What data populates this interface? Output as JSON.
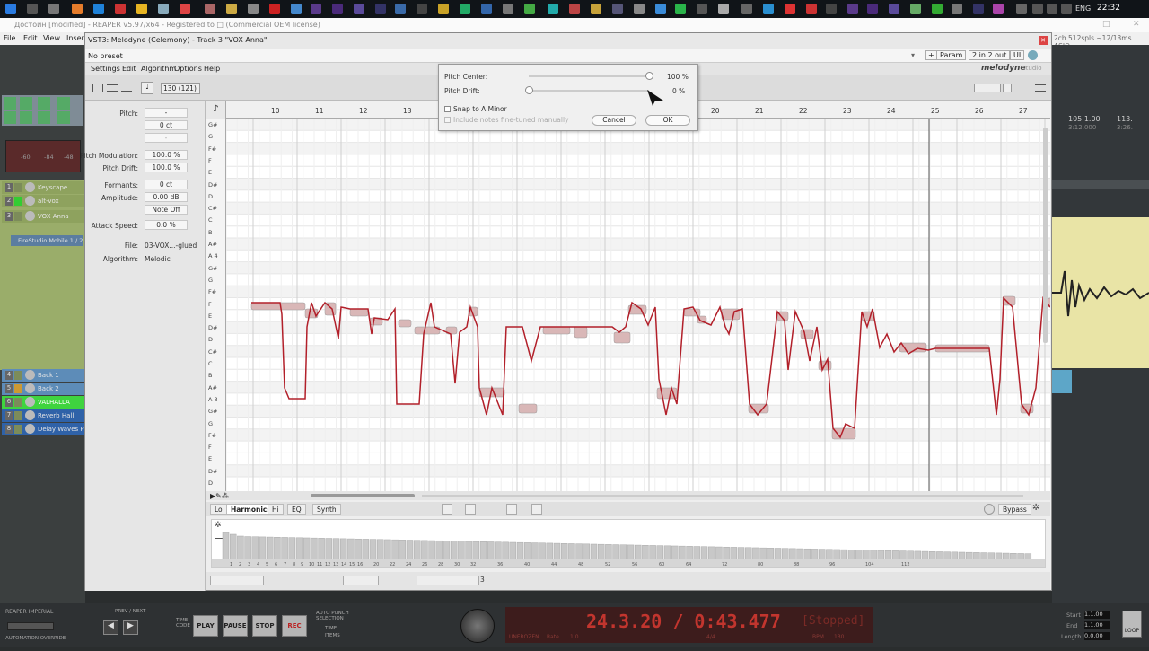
{
  "taskbar": {
    "lang": "ENG",
    "time": "22:32"
  },
  "app": {
    "title": "Достоин [modified] - REAPER v5.97/x64 - Registered to □ (Commercial OEM license)",
    "status_right": "2ch 512spls ~12/13ms ASIO"
  },
  "menu": [
    "File",
    "Edit",
    "View",
    "Insert"
  ],
  "plugin": {
    "title": "VST3: Melodyne (Celemony) - Track 3 \"VOX Anna\"",
    "preset": "No preset",
    "param_btn": "Param",
    "io_btn": "2 in 2 out",
    "ui_btn": "UI",
    "plus_btn": "+",
    "close_btn": "x"
  },
  "melodyne": {
    "logo": "melodyne",
    "logo_sub": "studio",
    "menu": [
      "Settings",
      "Edit",
      "Algorithm",
      "Options",
      "Help"
    ],
    "tempo": "130 (121)"
  },
  "inspector": {
    "pitch_label": "Pitch:",
    "pitch_val": "-",
    "pitch_ct": "0 ct",
    "pitch_extra": "-",
    "pitch_mod_label": "Pitch Modulation:",
    "pitch_mod": "100.0 %",
    "pitch_drift_label": "Pitch Drift:",
    "pitch_drift": "100.0 %",
    "formants_label": "Formants:",
    "formants": "0 ct",
    "amplitude_label": "Amplitude:",
    "amplitude": "0.00 dB",
    "note_off": "Note Off",
    "attack_label": "Attack Speed:",
    "attack": "0.0 %",
    "file_label": "File:",
    "file": "03-VOX...-glued",
    "algorithm_label": "Algorithm:",
    "algorithm": "Melodic"
  },
  "ruler": [
    "10",
    "11",
    "12",
    "13",
    "20",
    "21",
    "22",
    "23",
    "24",
    "25",
    "26",
    "27"
  ],
  "piano_keys": [
    "G#",
    "G",
    "F#",
    "F",
    "E",
    "D#",
    "D",
    "C#",
    "C",
    "B",
    "A#",
    "A 4",
    "G#",
    "G",
    "F#",
    "F",
    "E",
    "D#",
    "D",
    "C#",
    "C",
    "B",
    "A#",
    "A 3",
    "G#",
    "G",
    "F#",
    "F",
    "E",
    "D#",
    "D"
  ],
  "dialog": {
    "pitch_center_label": "Pitch Center:",
    "pitch_center": "100 %",
    "pitch_center_level": 1.0,
    "pitch_drift_label": "Pitch Drift:",
    "pitch_drift": "0 %",
    "pitch_drift_level": 0.0,
    "snap_label": "Snap to A Minor",
    "include_label": "Include notes fine-tuned manually",
    "cancel": "Cancel",
    "ok": "OK"
  },
  "bottom_tabs": [
    "Lo",
    "Harmonics",
    "Hi",
    "EQ",
    "Synth"
  ],
  "bypass": "Bypass",
  "spectrum_labels": [
    "1",
    "2",
    "3",
    "4",
    "5",
    "6",
    "7",
    "8",
    "9",
    "10",
    "11",
    "12",
    "13",
    "14",
    "15",
    "16",
    "20",
    "22",
    "24",
    "26",
    "28",
    "30",
    "32",
    "36",
    "40",
    "44",
    "48",
    "52",
    "56",
    "60",
    "64",
    "72",
    "80",
    "88",
    "96",
    "104",
    "112"
  ],
  "spec_ctrl_val": "3",
  "tracks": [
    {
      "num": "1",
      "name": "Keyscape"
    },
    {
      "num": "2",
      "name": "alt-vox"
    },
    {
      "num": "3",
      "name": "VOX Anna"
    },
    {
      "num": "4",
      "name": "Back 1"
    },
    {
      "num": "5",
      "name": "Back 2"
    },
    {
      "num": "6",
      "name": "VALHALLA"
    },
    {
      "num": "7",
      "name": "Reverb Hall"
    },
    {
      "num": "8",
      "name": "Delay Waves P"
    }
  ],
  "fx_slot": "FireStudio Mobile 1 / 2",
  "meter_vals": [
    "-60",
    "-84",
    "-48"
  ],
  "right_panel": {
    "pos1": "105.1.00",
    "time1": "3:12.000",
    "pos2": "113.",
    "time2": "3:26."
  },
  "transport": {
    "title": "REAPER IMPERIAL",
    "automation": "AUTOMATION OVERRIDE",
    "prev_next": "PREV / NEXT",
    "timecode": "TIME CODE",
    "play": "PLAY",
    "pause": "PAUSE",
    "stop": "STOP",
    "rec": "REC",
    "auto_punch": "AUTO PUNCH SELECTION",
    "time_opt": "TIME",
    "items_opt": "ITEMS",
    "position": "24.3.20 / 0:43.477",
    "state": "[Stopped]",
    "unfrozen": "UNFROZEN",
    "rate_label": "Rate",
    "rate": "1.0",
    "sig": "4/4",
    "bpm_label": "BPM",
    "bpm": "130",
    "start_label": "Start",
    "start": "1.1.00",
    "end_label": "End",
    "end": "1.1.00",
    "length_label": "Length",
    "length": "0.0.00",
    "loop": "LOOP"
  },
  "colors": {
    "accent_note": "#b2202a",
    "track_green": "#8aa85a",
    "track_blue": "#3a6ea6",
    "valhalla": "#3fd43f",
    "lcd": "#c2352e"
  }
}
